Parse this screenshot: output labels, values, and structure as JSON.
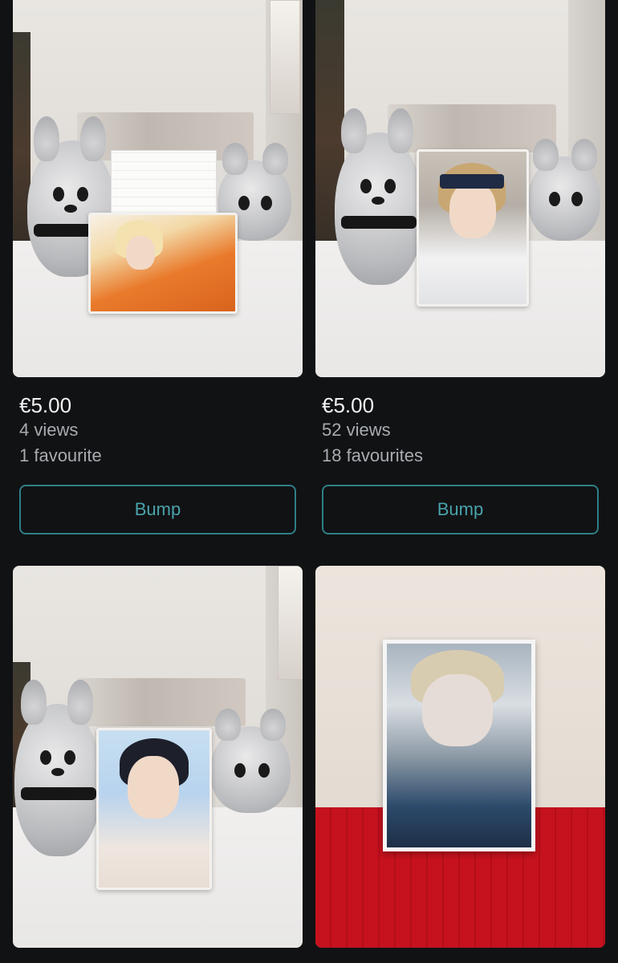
{
  "listings": [
    {
      "price": "€5.00",
      "views": "4 views",
      "favourites": "1 favourite",
      "bump_label": "Bump"
    },
    {
      "price": "€5.00",
      "views": "52 views",
      "favourites": "18 favourites",
      "bump_label": "Bump"
    },
    {},
    {}
  ],
  "colors": {
    "background": "#111214",
    "price_text": "#f2f2f2",
    "meta_text": "#a7acb1",
    "bump_border": "#2e7f87",
    "bump_text": "#4aa3ac"
  }
}
